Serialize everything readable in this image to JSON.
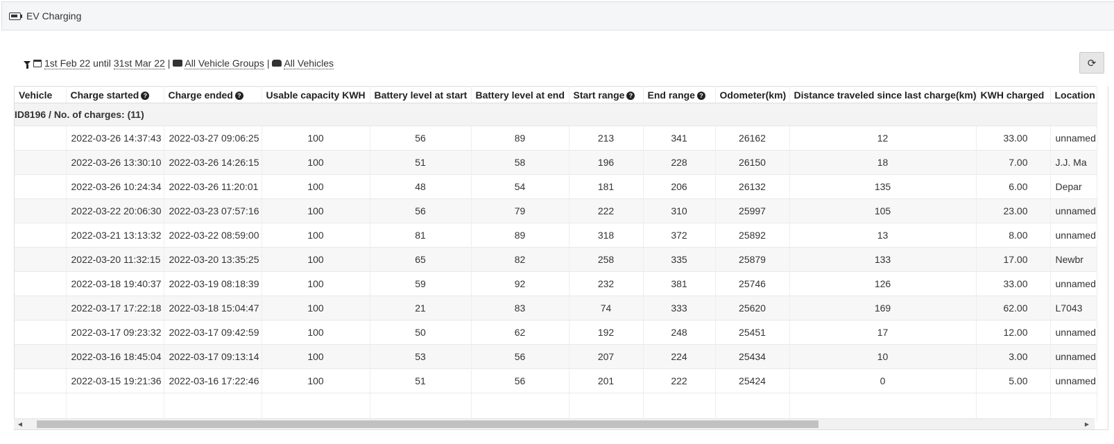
{
  "header": {
    "title": "EV Charging",
    "icon": "battery-icon"
  },
  "filters": {
    "date_from": "1st Feb 22",
    "until_label": "until",
    "date_to": "31st Mar 22",
    "separator": "|",
    "vehicle_groups": "All Vehicle Groups",
    "vehicles": "All Vehicles"
  },
  "toolbar": {
    "refresh_icon": "⟳"
  },
  "table": {
    "columns": [
      {
        "label": "Vehicle",
        "help": false
      },
      {
        "label": "Charge started",
        "help": true
      },
      {
        "label": "Charge ended",
        "help": true
      },
      {
        "label": "Usable capacity KWH",
        "help": false
      },
      {
        "label": "Battery level at start",
        "help": false
      },
      {
        "label": "Battery level at end",
        "help": false
      },
      {
        "label": "Start range",
        "help": true
      },
      {
        "label": "End range",
        "help": true
      },
      {
        "label": "Odometer(km)",
        "help": false
      },
      {
        "label": "Distance traveled since last charge(km)",
        "help": false
      },
      {
        "label": "KWH charged",
        "help": false
      },
      {
        "label": "Location",
        "help": false
      }
    ],
    "help_glyph": "?",
    "group_label": "ID8196 / No. of charges: (11)",
    "rows": [
      [
        "",
        "2022-03-26 14:37:43",
        "2022-03-27 09:06:25",
        "100",
        "56",
        "89",
        "213",
        "341",
        "26162",
        "12",
        "33.00",
        "unnamed"
      ],
      [
        "",
        "2022-03-26 13:30:10",
        "2022-03-26 14:26:15",
        "100",
        "51",
        "58",
        "196",
        "228",
        "26150",
        "18",
        "7.00",
        "J.J. Ma"
      ],
      [
        "",
        "2022-03-26 10:24:34",
        "2022-03-26 11:20:01",
        "100",
        "48",
        "54",
        "181",
        "206",
        "26132",
        "135",
        "6.00",
        "Depar"
      ],
      [
        "",
        "2022-03-22 20:06:30",
        "2022-03-23 07:57:16",
        "100",
        "56",
        "79",
        "222",
        "310",
        "25997",
        "105",
        "23.00",
        "unnamed"
      ],
      [
        "",
        "2022-03-21 13:13:32",
        "2022-03-22 08:59:00",
        "100",
        "81",
        "89",
        "318",
        "372",
        "25892",
        "13",
        "8.00",
        "unnamed"
      ],
      [
        "",
        "2022-03-20 11:32:15",
        "2022-03-20 13:35:25",
        "100",
        "65",
        "82",
        "258",
        "335",
        "25879",
        "133",
        "17.00",
        "Newbr"
      ],
      [
        "",
        "2022-03-18 19:40:37",
        "2022-03-19 08:18:39",
        "100",
        "59",
        "92",
        "232",
        "381",
        "25746",
        "126",
        "33.00",
        "unnamed"
      ],
      [
        "",
        "2022-03-17 17:22:18",
        "2022-03-18 15:04:47",
        "100",
        "21",
        "83",
        "74",
        "333",
        "25620",
        "169",
        "62.00",
        "L7043"
      ],
      [
        "",
        "2022-03-17 09:23:32",
        "2022-03-17 09:42:59",
        "100",
        "50",
        "62",
        "192",
        "248",
        "25451",
        "17",
        "12.00",
        "unnamed"
      ],
      [
        "",
        "2022-03-16 18:45:04",
        "2022-03-17 09:13:14",
        "100",
        "53",
        "56",
        "207",
        "224",
        "25434",
        "10",
        "3.00",
        "unnamed"
      ],
      [
        "",
        "2022-03-15 19:21:36",
        "2022-03-16 17:22:46",
        "100",
        "51",
        "56",
        "201",
        "222",
        "25424",
        "0",
        "5.00",
        "unnamed"
      ]
    ]
  },
  "scrollbar": {
    "left_arrow": "◀",
    "right_arrow": "▶"
  }
}
